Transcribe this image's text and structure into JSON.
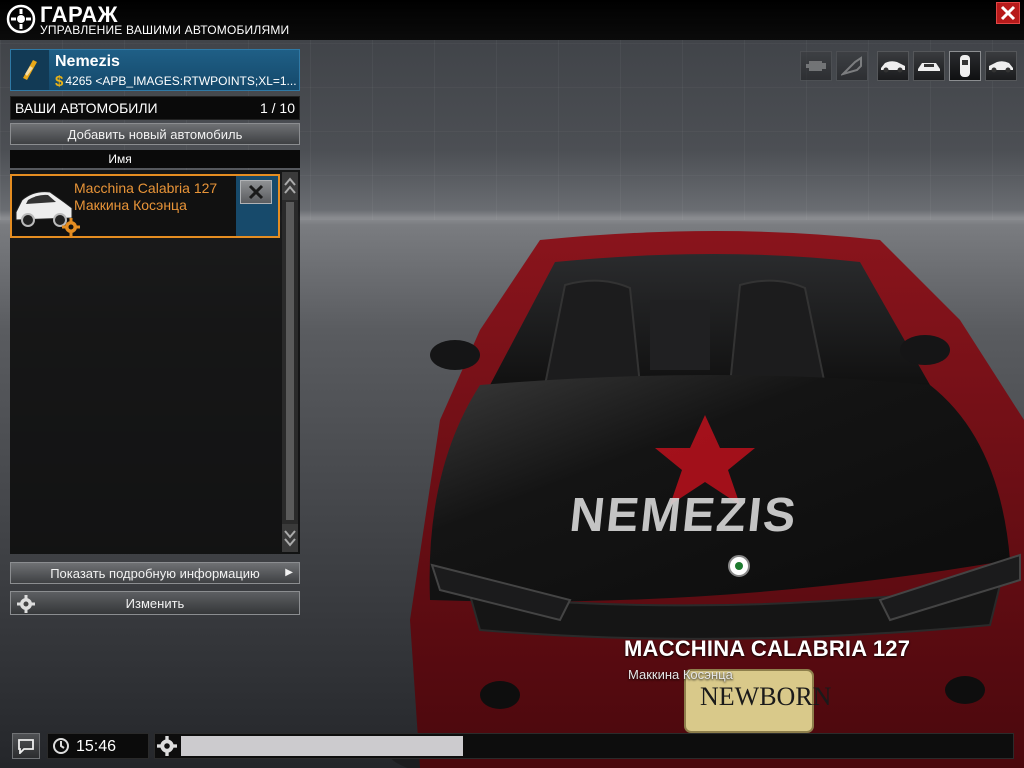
{
  "header": {
    "title": "ГАРАЖ",
    "subtitle": "УПРАВЛЕНИЕ ВАШИМИ АВТОМОБИЛЯМИ",
    "close_icon": "close-icon"
  },
  "player": {
    "name": "Nemezis",
    "money": "4265 <APB_IMAGES:RTWPOINTS;XL=1...",
    "rank_icon": "rank-chevron-icon"
  },
  "cars_panel": {
    "title": "ВАШИ АВТОМОБИЛИ",
    "count": "1 / 10",
    "add_button": "Добавить новый автомобиль",
    "column_name": "Имя",
    "cars": [
      {
        "model": "Macchina Calabria 127",
        "nickname": "Маккина Косэнца",
        "selected": true
      }
    ],
    "details_button": "Показать подробную информацию",
    "edit_button": "Изменить"
  },
  "toolbar": {
    "groups": [
      [
        "engine-icon",
        "horn-icon"
      ],
      [
        "car-side-icon",
        "car-front-icon",
        "car-top-icon",
        "car-rear-icon"
      ]
    ]
  },
  "vehicle": {
    "title": "MACCHINA CALABRIA 127",
    "subtitle": "Маккина Косэнца",
    "hood_text": "NEMEZIS",
    "plate": "NEWBORN",
    "colors": {
      "body": "#7a1017",
      "hood": "#151515",
      "accent": "#b3111c"
    }
  },
  "bottom_bar": {
    "time": "15:46",
    "progress": 0.34
  },
  "colors": {
    "accent_orange": "#e58d21",
    "accent_blue": "#1f5f86",
    "close_red": "#b71a1a"
  }
}
